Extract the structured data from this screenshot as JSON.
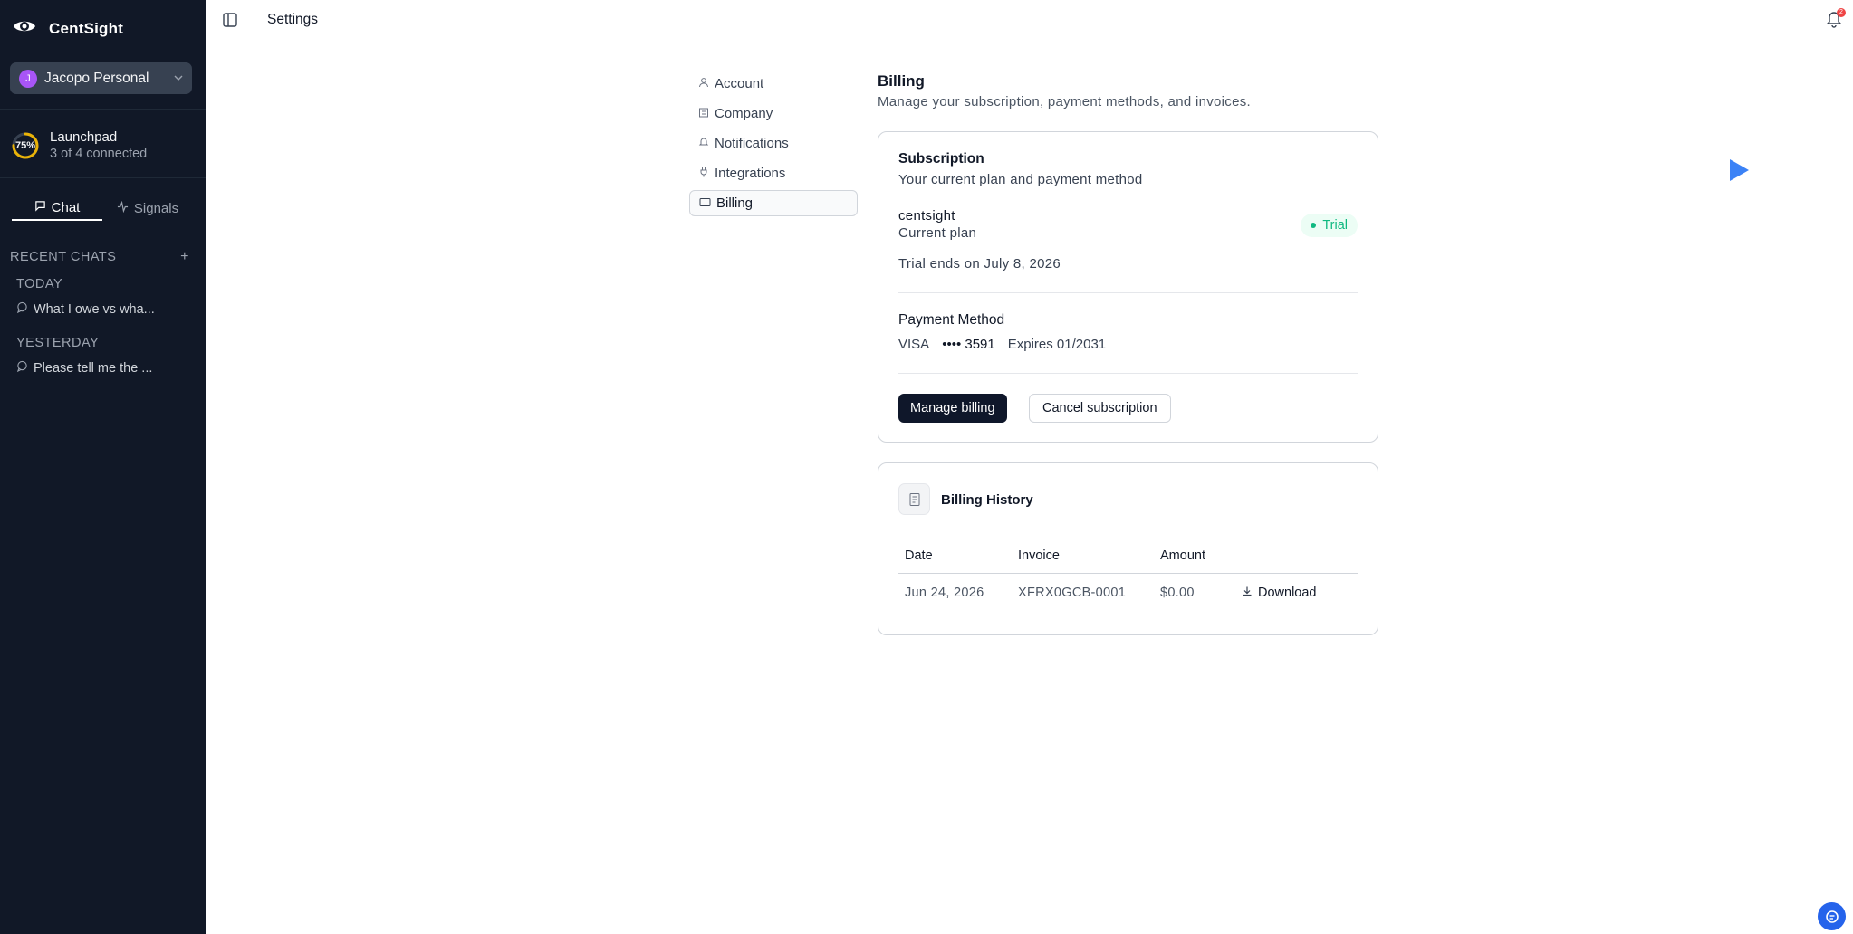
{
  "sidebar": {
    "brand": "CentSight",
    "workspace": {
      "initial": "J",
      "name": "Jacopo Personal"
    },
    "launchpad": {
      "percent": "75%",
      "title": "Launchpad",
      "subtitle": "3 of 4 connected",
      "progress": 0.75
    },
    "tabs": [
      {
        "label": "Chat"
      },
      {
        "label": "Signals"
      }
    ],
    "recent_chats_label": "RECENT CHATS",
    "groups": [
      {
        "label": "TODAY",
        "chats": [
          "What I owe vs wha..."
        ]
      },
      {
        "label": "YESTERDAY",
        "chats": [
          "Please tell me the ..."
        ]
      }
    ]
  },
  "topbar": {
    "title": "Settings",
    "notification_count": "2"
  },
  "settings_nav": [
    {
      "label": "Account"
    },
    {
      "label": "Company"
    },
    {
      "label": "Notifications"
    },
    {
      "label": "Integrations"
    },
    {
      "label": "Billing"
    }
  ],
  "billing": {
    "title": "Billing",
    "subtitle": "Manage your subscription, payment methods, and invoices.",
    "subscription": {
      "title": "Subscription",
      "subtitle": "Your current plan and payment method",
      "plan_name": "centsight",
      "plan_label": "Current plan",
      "badge": "Trial",
      "trial_ends": "Trial ends on July 8, 2026"
    },
    "payment": {
      "title": "Payment Method",
      "brand": "VISA",
      "masked": "•••• 3591",
      "expires": "Expires 01/2031"
    },
    "buttons": {
      "manage": "Manage billing",
      "cancel": "Cancel subscription"
    },
    "history": {
      "title": "Billing History",
      "columns": [
        "Date",
        "Invoice",
        "Amount"
      ],
      "rows": [
        {
          "date": "Jun 24, 2026",
          "invoice": "XFRX0GCB-0001",
          "amount": "$0.00",
          "action": "Download"
        }
      ]
    }
  },
  "colors": {
    "sidebar_bg": "#111827",
    "accent": "#0f172a",
    "trial_green": "#10b981",
    "play_blue": "#3b82f6"
  }
}
